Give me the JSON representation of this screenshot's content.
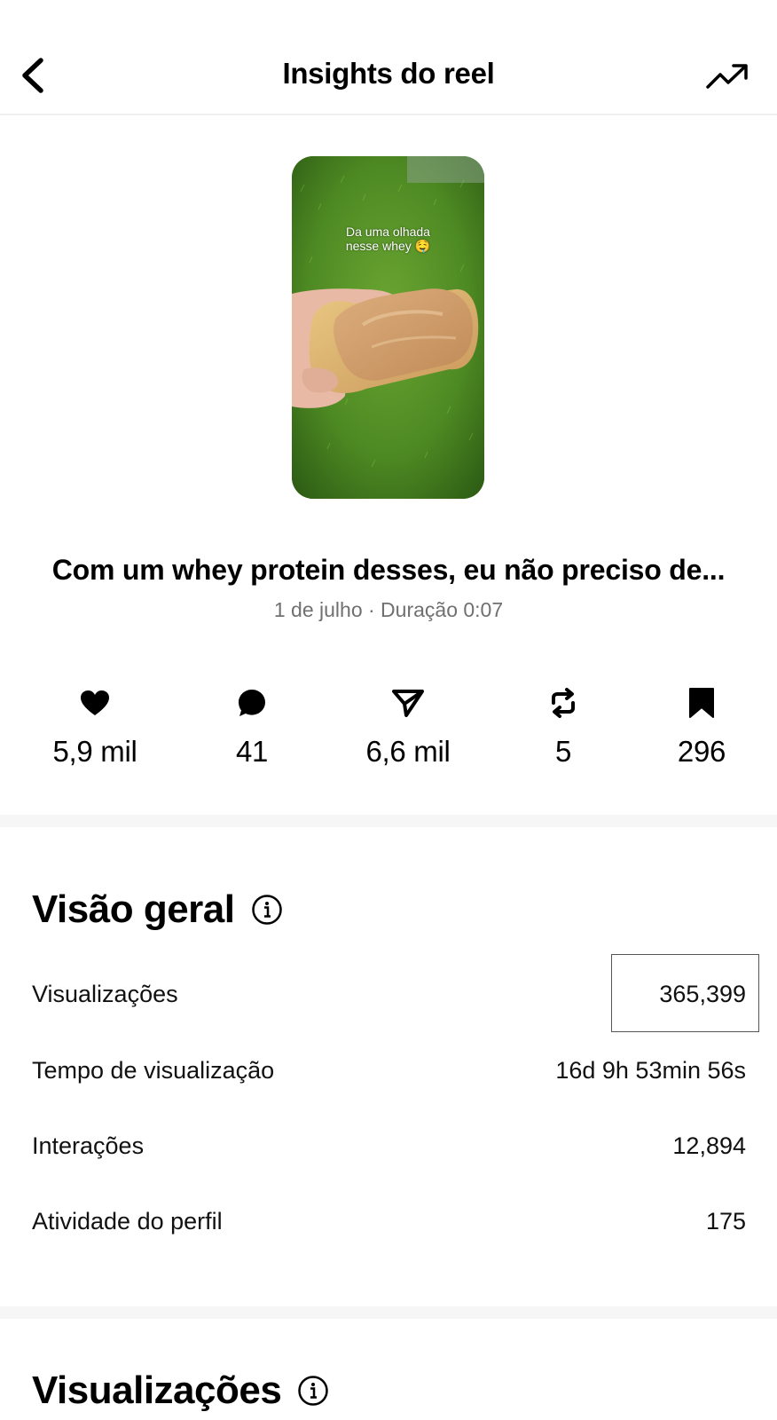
{
  "header": {
    "title": "Insights do reel",
    "back_icon": "chevron-left-icon",
    "trend_icon": "trending-up-icon"
  },
  "reel": {
    "thumbnail_caption": "Da uma olhada\nnesse whey 🤤",
    "title": "Com um whey protein desses, eu não preciso de...",
    "meta": "1 de julho · Duração 0:07"
  },
  "stats": [
    {
      "icon": "heart-icon",
      "value": "5,9 mil"
    },
    {
      "icon": "comment-icon",
      "value": "41"
    },
    {
      "icon": "send-icon",
      "value": "6,6 mil"
    },
    {
      "icon": "repost-icon",
      "value": "5"
    },
    {
      "icon": "bookmark-icon",
      "value": "296"
    }
  ],
  "overview": {
    "title": "Visão geral",
    "rows": [
      {
        "label": "Visualizações",
        "value": "365,399"
      },
      {
        "label": "Tempo de visualização",
        "value": "16d 9h 53min 56s"
      },
      {
        "label": "Interações",
        "value": "12,894"
      },
      {
        "label": "Atividade do perfil",
        "value": "175"
      }
    ]
  },
  "views_section": {
    "title": "Visualizações"
  },
  "colors": {
    "text": "#000000",
    "muted": "#707070",
    "separator": "#f6f6f6",
    "highlight_border": "#555555"
  }
}
